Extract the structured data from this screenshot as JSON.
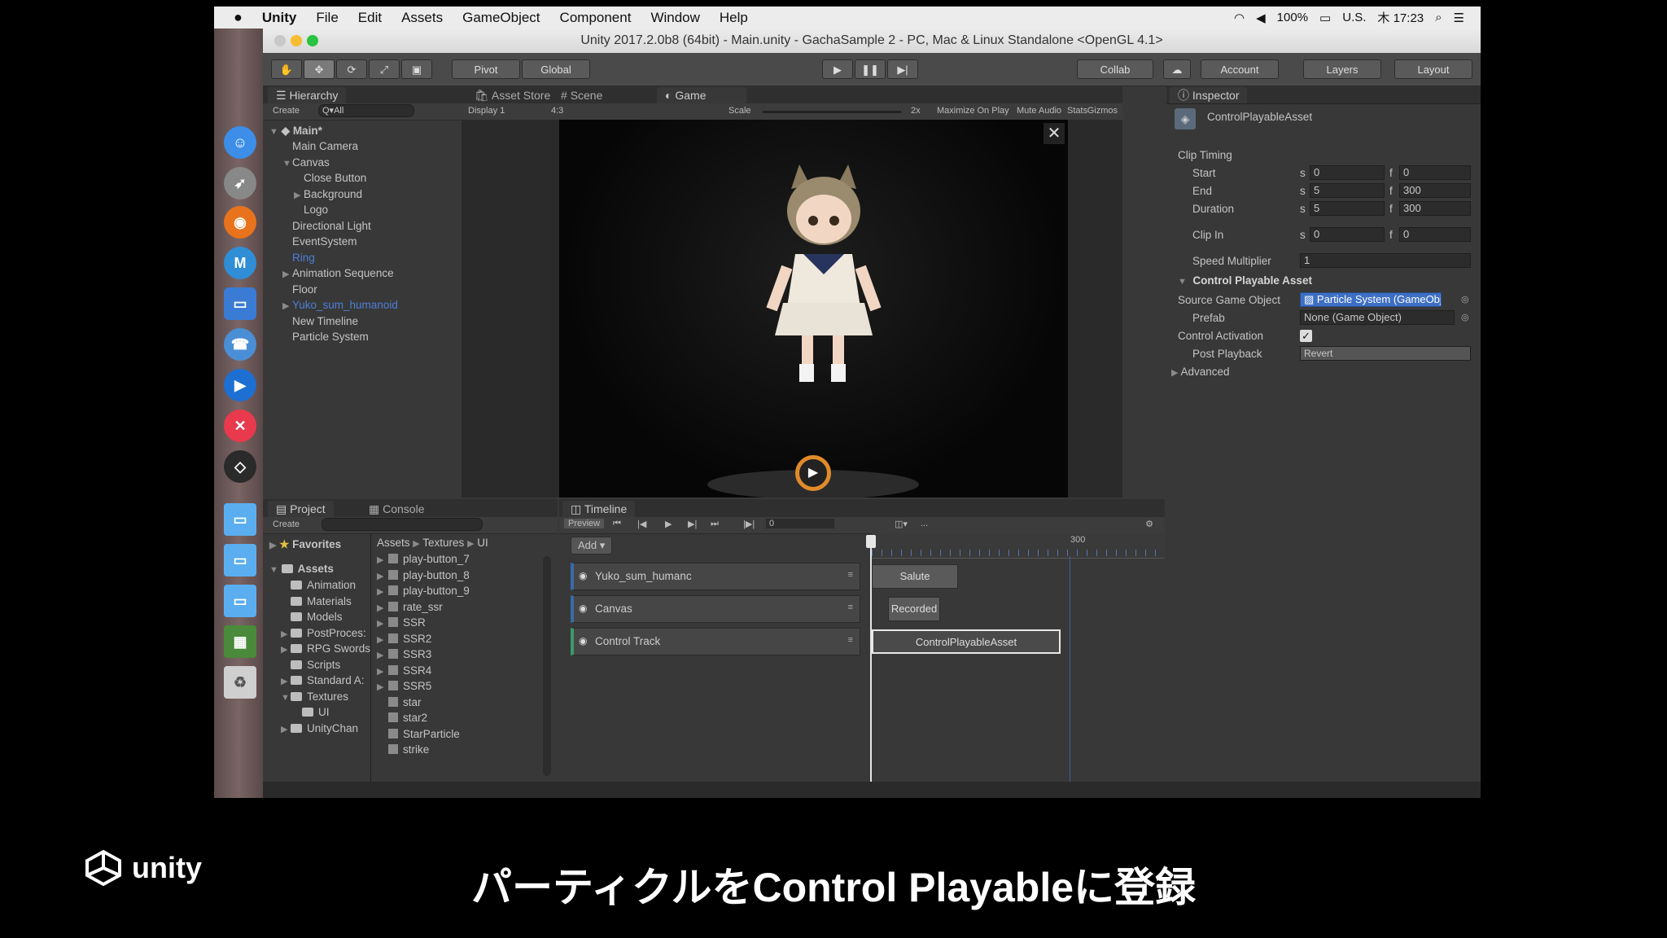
{
  "menubar": {
    "apple": "",
    "items": [
      "Unity",
      "File",
      "Edit",
      "Assets",
      "GameObject",
      "Component",
      "Window",
      "Help"
    ],
    "battery": "100%",
    "input": "U.S.",
    "clock": "木 17:23"
  },
  "window": {
    "title": "Unity 2017.2.0b8 (64bit) - Main.unity - GachaSample 2 - PC, Mac & Linux Standalone <OpenGL 4.1>"
  },
  "toolbar": {
    "pivot": "Pivot",
    "global": "Global",
    "collab": "Collab",
    "account": "Account",
    "layers": "Layers",
    "layout": "Layout"
  },
  "hierarchy": {
    "tab": "Hierarchy",
    "create": "Create",
    "search_placeholder": "Q▾All",
    "scene": "Main*",
    "items": [
      {
        "label": "Main Camera",
        "indent": 1,
        "arrow": "",
        "blue": false
      },
      {
        "label": "Canvas",
        "indent": 1,
        "arrow": "▼",
        "blue": false
      },
      {
        "label": "Close Button",
        "indent": 2,
        "arrow": "",
        "blue": false
      },
      {
        "label": "Background",
        "indent": 2,
        "arrow": "▶",
        "blue": false
      },
      {
        "label": "Logo",
        "indent": 2,
        "arrow": "",
        "blue": false
      },
      {
        "label": "Directional Light",
        "indent": 1,
        "arrow": "",
        "blue": false
      },
      {
        "label": "EventSystem",
        "indent": 1,
        "arrow": "",
        "blue": false
      },
      {
        "label": "Ring",
        "indent": 1,
        "arrow": "",
        "blue": true
      },
      {
        "label": "Animation Sequence",
        "indent": 1,
        "arrow": "▶",
        "blue": false
      },
      {
        "label": "Floor",
        "indent": 1,
        "arrow": "",
        "blue": false
      },
      {
        "label": "Yuko_sum_humanoid",
        "indent": 1,
        "arrow": "▶",
        "blue": true
      },
      {
        "label": "New Timeline",
        "indent": 1,
        "arrow": "",
        "blue": false
      },
      {
        "label": "Particle System",
        "indent": 1,
        "arrow": "",
        "blue": false
      }
    ]
  },
  "center_tabs": {
    "asset_store": "Asset Store",
    "scene": "Scene",
    "game": "Game",
    "display": "Display 1",
    "aspect": "4:3",
    "scale_label": "Scale",
    "scale_value": "2x",
    "maximize": "Maximize On Play",
    "mute": "Mute Audio",
    "stats": "Stats",
    "gizmos": "Gizmos"
  },
  "inspector": {
    "tab": "Inspector",
    "asset_name": "ControlPlayableAsset",
    "clip_timing": "Clip Timing",
    "rows": [
      {
        "label": "Start",
        "s": "0",
        "f": "0"
      },
      {
        "label": "End",
        "s": "5",
        "f": "300"
      },
      {
        "label": "Duration",
        "s": "5",
        "f": "300"
      },
      {
        "label": "Clip In",
        "s": "0",
        "f": "0"
      }
    ],
    "speed_label": "Speed Multiplier",
    "speed_value": "1",
    "section": "Control Playable Asset",
    "source_label": "Source Game Object",
    "source_value": "Particle System (GameObject)",
    "prefab_label": "Prefab",
    "prefab_value": "None (Game Object)",
    "activation_label": "Control Activation",
    "post_label": "Post Playback",
    "post_value": "Revert",
    "advanced": "Advanced",
    "s_unit": "s",
    "f_unit": "f"
  },
  "project": {
    "tab": "Project",
    "console_tab": "Console",
    "create": "Create",
    "favorites": "Favorites",
    "assets_root": "Assets",
    "folders": [
      {
        "label": "Animation",
        "indent": 1,
        "arrow": ""
      },
      {
        "label": "Materials",
        "indent": 1,
        "arrow": ""
      },
      {
        "label": "Models",
        "indent": 1,
        "arrow": ""
      },
      {
        "label": "PostProces:",
        "indent": 1,
        "arrow": "▶"
      },
      {
        "label": "RPG Swords",
        "indent": 1,
        "arrow": "▶"
      },
      {
        "label": "Scripts",
        "indent": 1,
        "arrow": ""
      },
      {
        "label": "Standard A:",
        "indent": 1,
        "arrow": "▶"
      },
      {
        "label": "Textures",
        "indent": 1,
        "arrow": "▼"
      },
      {
        "label": "UI",
        "indent": 2,
        "arrow": ""
      },
      {
        "label": "UnityChan",
        "indent": 1,
        "arrow": "▶"
      }
    ],
    "breadcrumb": [
      "Assets",
      "Textures",
      "UI"
    ],
    "files": [
      {
        "label": "play-button_7",
        "arrow": "▶"
      },
      {
        "label": "play-button_8",
        "arrow": "▶"
      },
      {
        "label": "play-button_9",
        "arrow": "▶"
      },
      {
        "label": "rate_ssr",
        "arrow": "▶"
      },
      {
        "label": "SSR",
        "arrow": "▶"
      },
      {
        "label": "SSR2",
        "arrow": "▶"
      },
      {
        "label": "SSR3",
        "arrow": "▶"
      },
      {
        "label": "SSR4",
        "arrow": "▶"
      },
      {
        "label": "SSR5",
        "arrow": "▶"
      },
      {
        "label": "star",
        "arrow": ""
      },
      {
        "label": "star2",
        "arrow": ""
      },
      {
        "label": "StarParticle",
        "arrow": ""
      },
      {
        "label": "strike",
        "arrow": ""
      }
    ]
  },
  "timeline": {
    "tab": "Timeline",
    "preview": "Preview",
    "frame": "0",
    "ellipsis": "...",
    "add": "Add",
    "ruler_mark": "300",
    "tracks": [
      {
        "label": "Yuko_sum_humanc",
        "clip": "Salute"
      },
      {
        "label": "Canvas",
        "clip": "Recorded"
      },
      {
        "label": "Control Track",
        "clip": "ControlPlayableAsset"
      }
    ]
  },
  "caption": "パーティクルをControl Playableに登録",
  "brand": "unity"
}
